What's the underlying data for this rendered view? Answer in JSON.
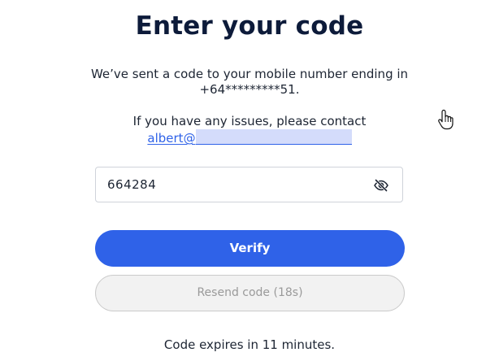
{
  "heading": {
    "title": "Enter your code"
  },
  "message": {
    "sent_line1": "We’ve sent a code to your mobile number ending in",
    "sent_line2": "+64*********51.",
    "issues_line": "If you have any issues, please contact",
    "contact_email_prefix": "albert@"
  },
  "code_input": {
    "value": "664284",
    "toggle_icon": "eye-slash-icon"
  },
  "buttons": {
    "verify_label": "Verify",
    "resend_label": "Resend code (18s)"
  },
  "footer": {
    "expiry_text": "Code expires in 11 minutes."
  },
  "colors": {
    "accent": "#2f62e8",
    "title": "#0d1b3a",
    "disabled_text": "#9a9a9a",
    "redaction": "#d4dcfb"
  }
}
